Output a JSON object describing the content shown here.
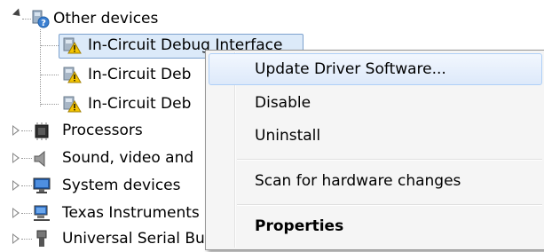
{
  "tree": {
    "other_devices": "Other devices",
    "children": [
      "In-Circuit Debug Interface",
      "In-Circuit Deb",
      "In-Circuit Deb"
    ],
    "categories": [
      "Processors",
      "Sound, video and",
      "System devices",
      "Texas Instruments",
      "Universal Serial Bu"
    ]
  },
  "context_menu": {
    "update": "Update Driver Software...",
    "disable": "Disable",
    "uninstall": "Uninstall",
    "scan": "Scan for hardware changes",
    "properties": "Properties"
  },
  "colors": {
    "selection_bg": "#dceaf9",
    "selection_border": "#7da2ce",
    "menu_bg": "#f5f5f5",
    "warning": "#f4c400"
  }
}
